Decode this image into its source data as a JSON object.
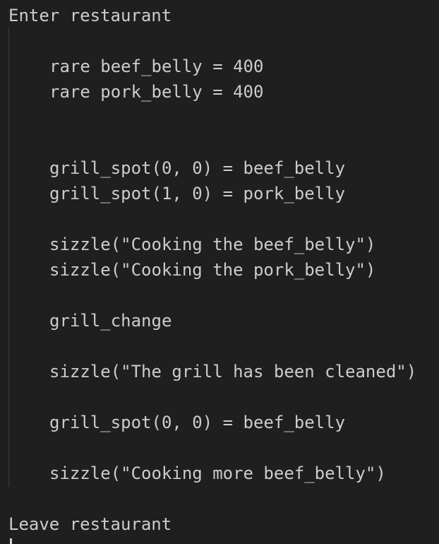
{
  "editor": {
    "lines": [
      "Enter restaurant",
      "rare beef_belly = 400",
      "rare pork_belly = 400",
      "grill_spot(0, 0) = beef_belly",
      "grill_spot(1, 0) = pork_belly",
      "sizzle(\"Cooking the beef_belly\")",
      "sizzle(\"Cooking the pork_belly\")",
      "grill_change",
      "sizzle(\"The grill has been cleaned\")",
      "grill_spot(0, 0) = beef_belly",
      "sizzle(\"Cooking more beef_belly\")",
      "Leave restaurant"
    ]
  }
}
